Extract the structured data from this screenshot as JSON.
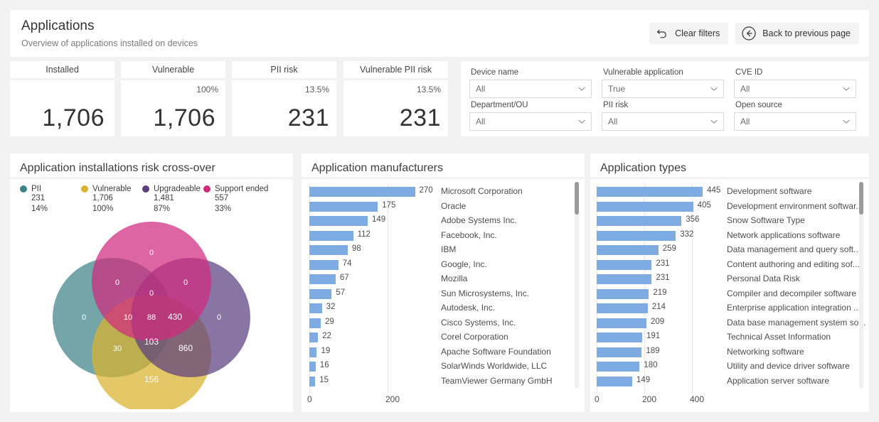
{
  "header": {
    "title": "Applications",
    "subtitle": "Overview of applications installed on devices",
    "clear_filters_label": "Clear filters",
    "back_label": "Back to previous page"
  },
  "kpis": [
    {
      "label": "Installed",
      "percent": "",
      "value": "1,706"
    },
    {
      "label": "Vulnerable",
      "percent": "100%",
      "value": "1,706"
    },
    {
      "label": "PII risk",
      "percent": "13.5%",
      "value": "231"
    },
    {
      "label": "Vulnerable PII risk",
      "percent": "13.5%",
      "value": "231"
    }
  ],
  "filters": [
    {
      "label": "Device name",
      "value": "All"
    },
    {
      "label": "Vulnerable application",
      "value": "True"
    },
    {
      "label": "CVE ID",
      "value": "All"
    },
    {
      "label": "Department/OU",
      "value": "All"
    },
    {
      "label": "PII risk",
      "value": "All"
    },
    {
      "label": "Open source",
      "value": "All"
    }
  ],
  "panels": {
    "venn_title": "Application installations risk cross-over",
    "manufacturers_title": "Application manufacturers",
    "types_title": "Application types"
  },
  "chart_data": [
    {
      "type": "venn",
      "title": "Application installations risk cross-over",
      "sets": [
        {
          "name": "PII",
          "value": "231",
          "percent": "14%",
          "color": "#3d8288"
        },
        {
          "name": "Vulnerable",
          "value": "1,706",
          "percent": "100%",
          "color": "#d9b32c"
        },
        {
          "name": "Upgradeable",
          "value": "1,481",
          "percent": "87%",
          "color": "#5b4080"
        },
        {
          "name": "Support ended",
          "value": "557",
          "percent": "33%",
          "color": "#d12a7f"
        }
      ],
      "regions": [
        {
          "id": "pii-only",
          "label": "0",
          "x": 44,
          "y": 139
        },
        {
          "id": "support-ended-only",
          "label": "0",
          "x": 139,
          "y": 48
        },
        {
          "id": "upgradeable-only",
          "label": "0",
          "x": 234,
          "y": 139
        },
        {
          "id": "vulnerable-only",
          "label": "156",
          "x": 139,
          "y": 227
        },
        {
          "id": "pii-support",
          "label": "0",
          "x": 91,
          "y": 90
        },
        {
          "id": "support-upgradeable",
          "label": "0",
          "x": 187,
          "y": 90
        },
        {
          "id": "pii-support-upgradeable",
          "label": "0",
          "x": 139,
          "y": 105
        },
        {
          "id": "pii-vulnerable",
          "label": "30",
          "x": 91,
          "y": 183
        },
        {
          "id": "vulnerable-upgradeable",
          "label": "860",
          "x": 187,
          "y": 183
        },
        {
          "id": "pii-vuln-upgradeable",
          "label": "10",
          "x": 106,
          "y": 139
        },
        {
          "id": "center-all-four",
          "label": "88",
          "x": 139,
          "y": 139
        },
        {
          "id": "support-vuln-upgradeable",
          "label": "430",
          "x": 172,
          "y": 139
        },
        {
          "id": "pii-vulnerable-lower",
          "label": "103",
          "x": 139,
          "y": 174
        }
      ]
    },
    {
      "type": "bar",
      "orientation": "horizontal",
      "title": "Application manufacturers",
      "xlabel": "",
      "ylabel": "",
      "xlim": [
        0,
        300
      ],
      "ticks": [
        "0",
        "200"
      ],
      "grid": true,
      "categories": [
        "Microsoft Corporation",
        "Oracle",
        "Adobe Systems Inc.",
        "Facebook, Inc.",
        "IBM",
        "Google, Inc.",
        "Mozilla",
        "Sun Microsystems, Inc.",
        "Autodesk, Inc.",
        "Cisco Systems, Inc.",
        "Corel Corporation",
        "Apache Software Foundation",
        "SolarWinds Worldwide, LLC",
        "TeamViewer Germany GmbH"
      ],
      "values": [
        270,
        175,
        149,
        112,
        98,
        74,
        67,
        57,
        32,
        29,
        22,
        19,
        16,
        15
      ],
      "color": "#7fabe3"
    },
    {
      "type": "bar",
      "orientation": "horizontal",
      "title": "Application types",
      "xlabel": "",
      "ylabel": "",
      "xlim": [
        0,
        500
      ],
      "ticks": [
        "0",
        "200",
        "400"
      ],
      "grid": true,
      "categories": [
        "Development software",
        "Development environment softwar...",
        "Snow Software Type",
        "Network applications software",
        "Data management and query soft...",
        "Content authoring and editing sof...",
        "Personal Data Risk",
        "Compiler and decompiler software",
        "Enterprise application integration ...",
        "Data base management system so...",
        "Technical Asset Information",
        "Networking software",
        "Utility and device driver software",
        "Application server software"
      ],
      "values": [
        445,
        405,
        356,
        332,
        259,
        231,
        231,
        219,
        214,
        209,
        191,
        189,
        180,
        149
      ],
      "color": "#7fabe3"
    }
  ]
}
